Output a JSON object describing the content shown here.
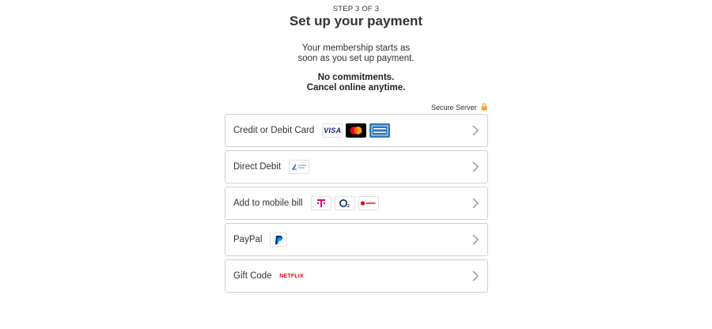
{
  "header": {
    "step": "STEP 3 OF 3",
    "title": "Set up your payment",
    "intro_line1": "Your membership starts as",
    "intro_line2": "soon as you set up payment.",
    "commit_line1": "No commitments.",
    "commit_line2": "Cancel online anytime."
  },
  "secure": {
    "label": "Secure Server",
    "icon": "lock-icon",
    "icon_color": "#f5a623"
  },
  "options": [
    {
      "label": "Credit or Debit Card",
      "logos": [
        "visa-icon",
        "mastercard-icon",
        "amex-icon"
      ]
    },
    {
      "label": "Direct Debit",
      "logos": [
        "sepa-icon"
      ]
    },
    {
      "label": "Add to mobile bill",
      "logos": [
        "telekom-icon",
        "o2-icon",
        "vodafone-icon"
      ]
    },
    {
      "label": "PayPal",
      "logos": [
        "paypal-icon"
      ]
    },
    {
      "label": "Gift Code",
      "logos": [
        "netflix-icon"
      ],
      "netflix_text": "NETFLIX"
    }
  ],
  "logo_text": {
    "visa": "VISA"
  },
  "colors": {
    "text": "#333333",
    "border": "#cfcfcf",
    "netflix_red": "#e50914",
    "telekom_magenta": "#e20074",
    "amex_blue": "#2e77bc",
    "paypal_blue": "#003087",
    "chevron": "#999999"
  }
}
